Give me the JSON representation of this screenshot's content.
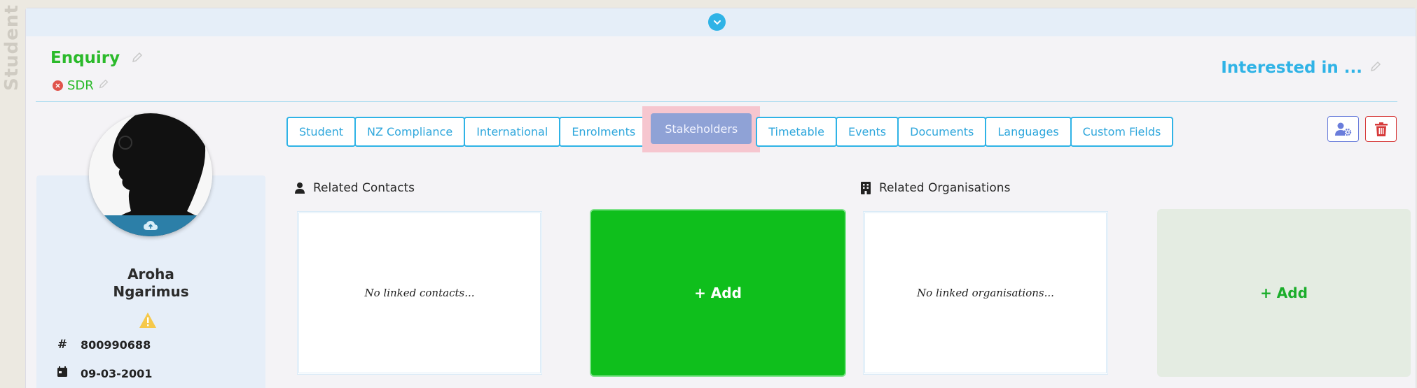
{
  "side_label": "Student",
  "status": {
    "title": "Enquiry",
    "sub_status": "SDR"
  },
  "interested": {
    "label": "Interested in ..."
  },
  "tabs": [
    {
      "label": "Student"
    },
    {
      "label": "NZ Compliance"
    },
    {
      "label": "International"
    },
    {
      "label": "Enrolments"
    },
    {
      "label": "Stakeholders",
      "active": true
    },
    {
      "label": "Timetable"
    },
    {
      "label": "Events"
    },
    {
      "label": "Documents"
    },
    {
      "label": "Languages"
    },
    {
      "label": "Custom Fields"
    }
  ],
  "profile": {
    "first_name": "Aroha",
    "last_name": "Ngarimus",
    "id_glyph": "#",
    "id_number": "800990688",
    "dob": "09-03-2001"
  },
  "related_contacts": {
    "heading": "Related Contacts",
    "empty_text": "No linked contacts...",
    "add_label": "+ Add"
  },
  "related_orgs": {
    "heading": "Related Organisations",
    "empty_text": "No linked organisations...",
    "add_label": "+ Add"
  },
  "icons": {
    "collapse": "chevron-down-icon",
    "edit": "pencil-icon",
    "warning": "warning-icon",
    "upload": "cloud-upload-icon",
    "user_settings": "user-gear-icon",
    "delete": "trash-icon"
  },
  "colors": {
    "status_green": "#2bba2b",
    "accent_blue": "#2fb3e6",
    "active_tab": "#8fa2d6",
    "add_green": "#0fbf1c",
    "danger_red": "#d63a3a"
  }
}
